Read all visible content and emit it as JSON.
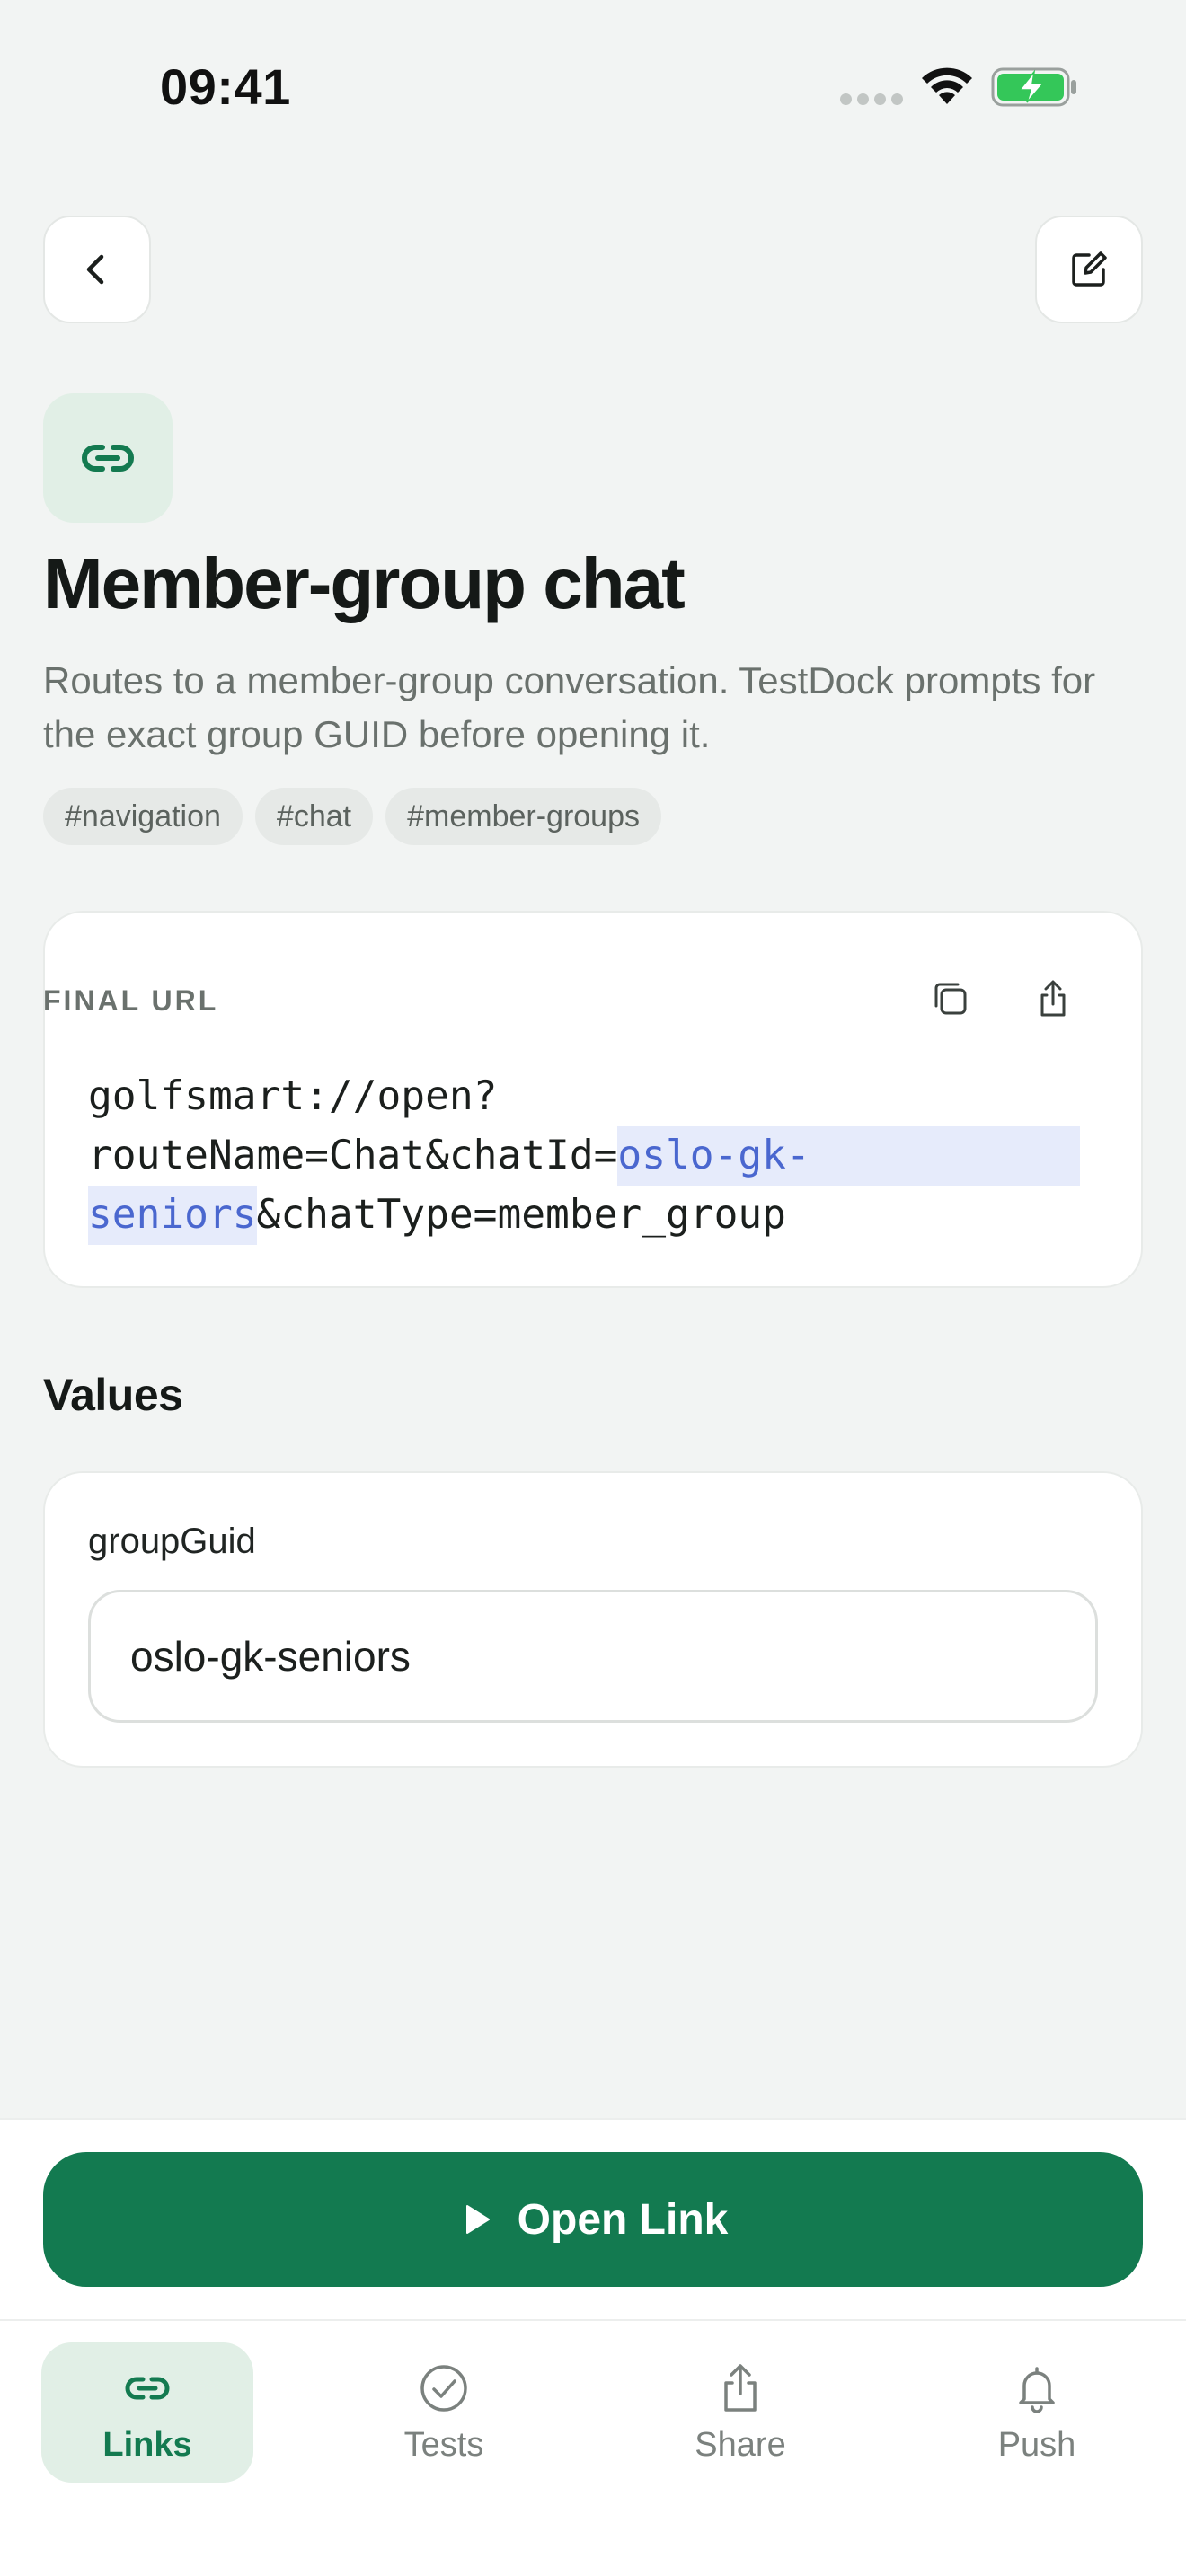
{
  "status_bar": {
    "time": "09:41"
  },
  "header": {
    "title": "Member-group chat",
    "description": "Routes to a member-group conversation. TestDock prompts for the exact group GUID before opening it.",
    "tags": [
      "#navigation",
      "#chat",
      "#member-groups"
    ]
  },
  "url_card": {
    "label": "FINAL URL",
    "line1": "golfsmart://open?",
    "line2_prefix": "routeName=Chat&chatId=",
    "line2_highlight": "oslo-gk-",
    "line3_highlight": "seniors",
    "line3_suffix": "&chatType=member_group"
  },
  "values": {
    "section_title": "Values",
    "field_label": "groupGuid",
    "field_value": "oslo-gk-seniors"
  },
  "actions": {
    "open_link_label": "Open Link"
  },
  "tabbar": {
    "tabs": [
      {
        "label": "Links",
        "icon": "link-icon",
        "active": true
      },
      {
        "label": "Tests",
        "icon": "check-circle-icon",
        "active": false
      },
      {
        "label": "Share",
        "icon": "share-icon",
        "active": false
      },
      {
        "label": "Push",
        "icon": "bell-icon",
        "active": false
      }
    ]
  },
  "colors": {
    "accent": "#137a50",
    "accent_tint": "#e1efe6",
    "highlight_text": "#4a67cf",
    "highlight_bg": "#e6ebfb"
  }
}
